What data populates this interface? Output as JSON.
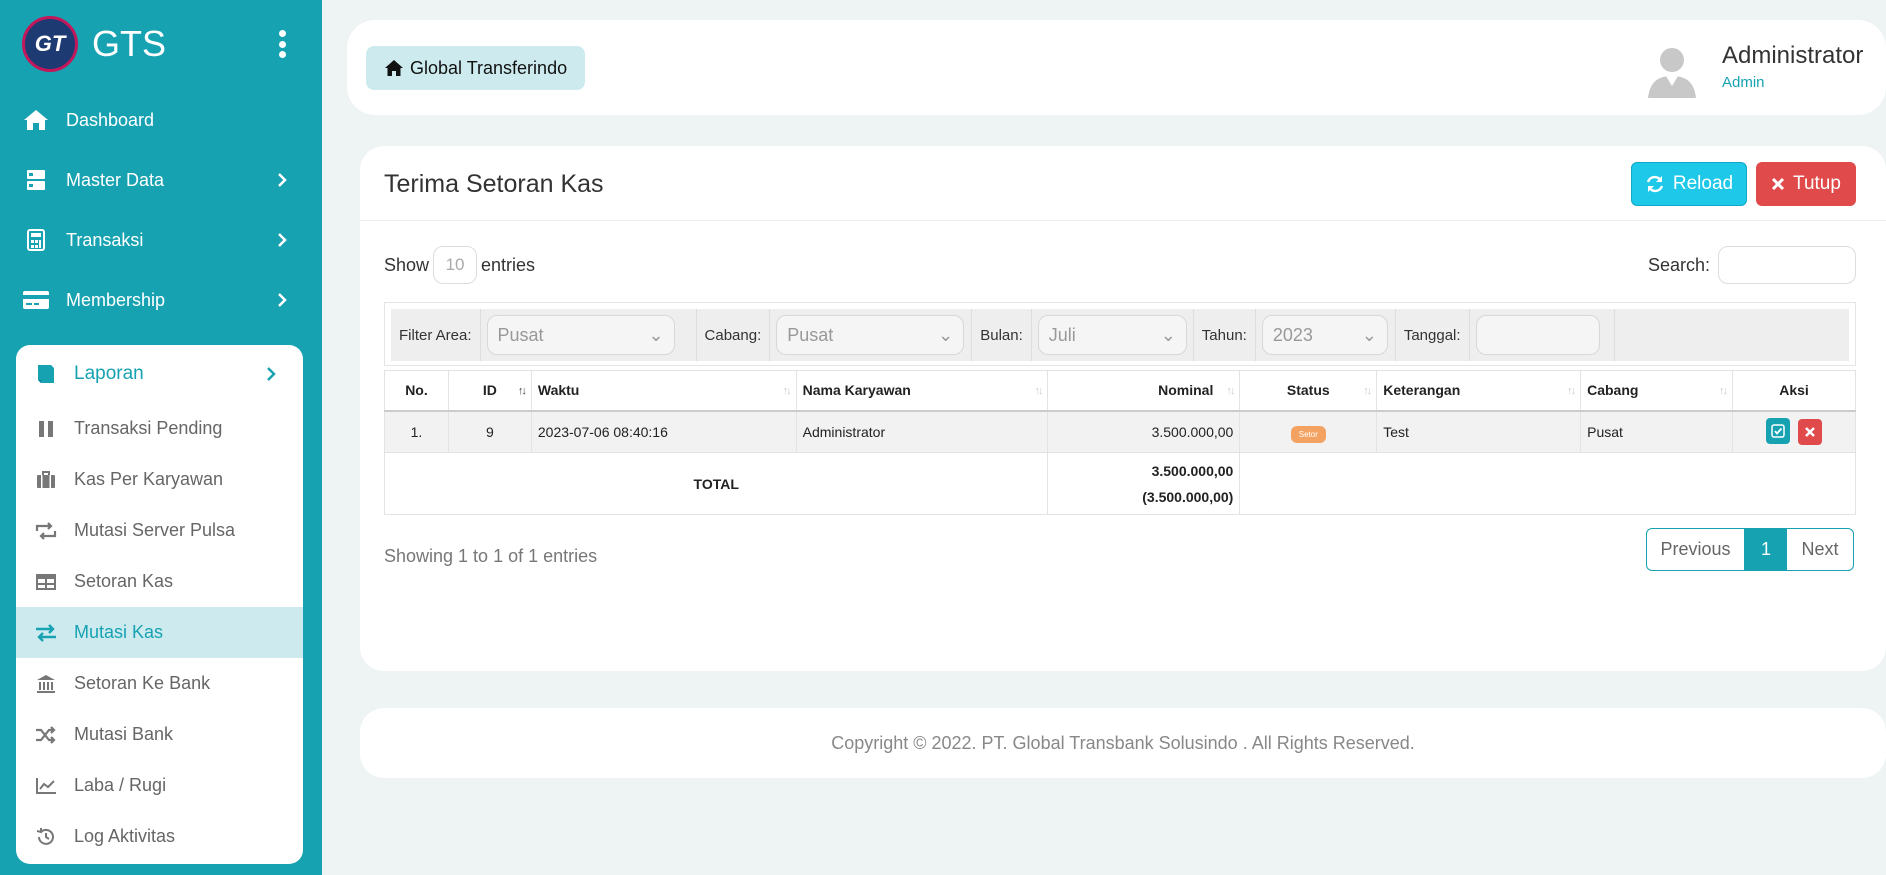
{
  "brand": {
    "name": "GTS",
    "logo_text": "GT"
  },
  "nav": {
    "dashboard": "Dashboard",
    "master_data": "Master Data",
    "transaksi": "Transaksi",
    "membership": "Membership"
  },
  "laporan": {
    "label": "Laporan",
    "items": [
      "Transaksi Pending",
      "Kas Per Karyawan",
      "Mutasi Server Pulsa",
      "Setoran Kas",
      "Mutasi Kas",
      "Setoran Ke Bank",
      "Mutasi Bank",
      "Laba / Rugi",
      "Log Aktivitas"
    ],
    "active": "Mutasi Kas"
  },
  "topbar": {
    "breadcrumb": "Global Transferindo",
    "user_name": "Administrator",
    "user_role": "Admin"
  },
  "page": {
    "title": "Terima Setoran Kas",
    "reload": "Reload",
    "close": "Tutup",
    "show_prefix": "Show",
    "page_length": "10",
    "show_suffix": "entries",
    "search_label": "Search:"
  },
  "filters": {
    "area_label": "Filter Area:",
    "area_value": "Pusat",
    "cabang_label": "Cabang:",
    "cabang_value": "Pusat",
    "bulan_label": "Bulan:",
    "bulan_value": "Juli",
    "tahun_label": "Tahun:",
    "tahun_value": "2023",
    "tanggal_label": "Tanggal:"
  },
  "table": {
    "headers": [
      "No.",
      "ID",
      "Waktu",
      "Nama Karyawan",
      "Nominal",
      "Status",
      "Keterangan",
      "Cabang",
      "Aksi"
    ],
    "rows": [
      {
        "no": "1.",
        "id": "9",
        "waktu": "2023-07-06 08:40:16",
        "nama": "Administrator",
        "nominal": "3.500.000,00",
        "status": "Setor",
        "keterangan": "Test",
        "cabang": "Pusat"
      }
    ],
    "total_label": "TOTAL",
    "total_value": "3.500.000,00",
    "total_neg": "(3.500.000,00)"
  },
  "pagination": {
    "info": "Showing 1 to 1 of 1 entries",
    "previous": "Previous",
    "current": "1",
    "next": "Next"
  },
  "footer": {
    "text": "Copyright © 2022. PT. Global Transbank Solusindo . All Rights Reserved."
  },
  "colors": {
    "primary": "#17a2b2",
    "reload": "#1ec8e8",
    "danger": "#e04a4a",
    "badge": "#f4a261"
  }
}
